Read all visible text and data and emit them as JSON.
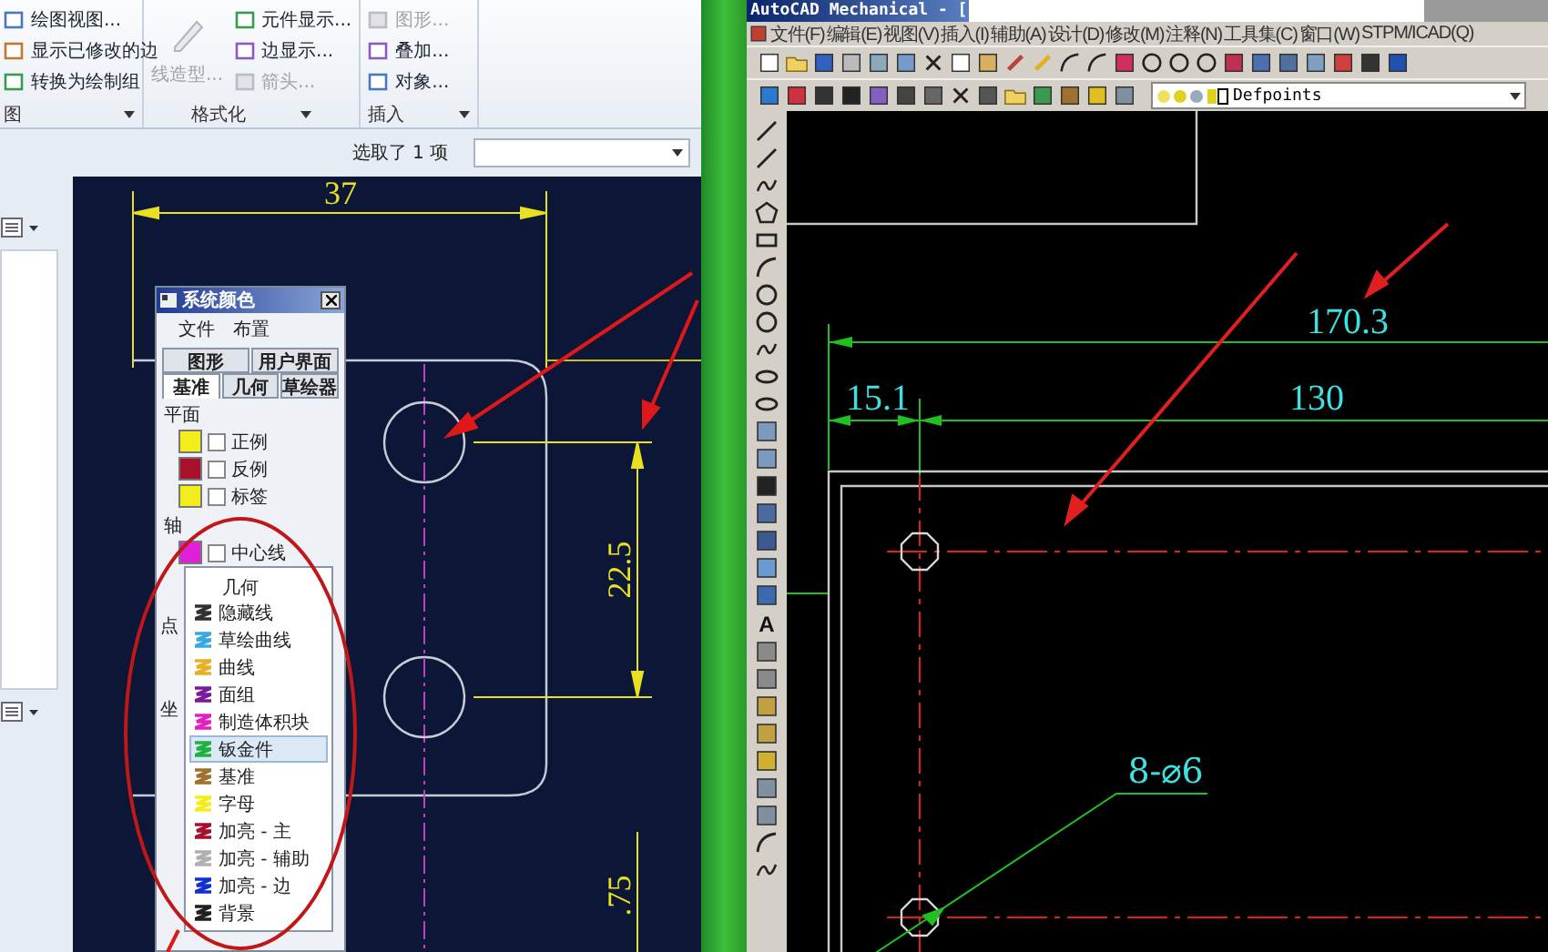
{
  "left_window": {
    "ribbon": {
      "groups": [
        {
          "label": "图",
          "items": [
            {
              "label": "绘图视图...",
              "kind": "small",
              "disabled": false
            },
            {
              "label": "显示已修改的边",
              "kind": "small",
              "disabled": false
            },
            {
              "label": "转换为绘制组",
              "kind": "small",
              "disabled": false
            }
          ]
        },
        {
          "label": "格式化",
          "items": [
            {
              "label": "线造型...",
              "kind": "large",
              "disabled": true
            },
            {
              "label": "元件显示...",
              "kind": "small",
              "disabled": false
            },
            {
              "label": "边显示...",
              "kind": "small",
              "disabled": false
            },
            {
              "label": "箭头...",
              "kind": "small",
              "disabled": true
            }
          ]
        },
        {
          "label": "插入",
          "items": [
            {
              "label": "图形...",
              "kind": "small",
              "disabled": true
            },
            {
              "label": "叠加...",
              "kind": "small",
              "disabled": false
            },
            {
              "label": "对象...",
              "kind": "small",
              "disabled": false
            }
          ]
        }
      ]
    },
    "selection_status": "选取了 1 项",
    "drawing": {
      "width_dimension": "37",
      "spacing_dimension": "22.5",
      "lower_dimension": ".75"
    },
    "dialog": {
      "title": "系统颜色",
      "menu": [
        "文件",
        "布置"
      ],
      "tab_rows": [
        [
          {
            "label": "图形",
            "selected": false
          },
          {
            "label": "用户界面",
            "selected": false
          }
        ],
        [
          {
            "label": "基准",
            "selected": true
          },
          {
            "label": "几何",
            "selected": false
          },
          {
            "label": "草绘器",
            "selected": false
          }
        ]
      ],
      "sections": [
        {
          "label": "平面",
          "rows": [
            {
              "label": "正例",
              "checked": false,
              "color": "#f2ee1c"
            },
            {
              "label": "反例",
              "checked": false,
              "color": "#a8102c"
            },
            {
              "label": "标签",
              "checked": false,
              "color": "#f2ee1c"
            }
          ]
        },
        {
          "label": "轴",
          "rows": [
            {
              "label": "中心线",
              "checked": false,
              "color": "#e020d8"
            }
          ]
        }
      ],
      "side_labels": [
        "点",
        "坐"
      ],
      "color_list": {
        "header": "几何",
        "items": [
          {
            "label": "隐藏线",
            "color": "#303030",
            "selected": false
          },
          {
            "label": "草绘曲线",
            "color": "#3aa8e0",
            "selected": false
          },
          {
            "label": "曲线",
            "color": "#e8b020",
            "selected": false
          },
          {
            "label": "面组",
            "color": "#7a1a9a",
            "selected": false
          },
          {
            "label": "制造体积块",
            "color": "#e020c0",
            "selected": false
          },
          {
            "label": "钣金件",
            "color": "#20b040",
            "selected": true
          },
          {
            "label": "基准",
            "color": "#a07030",
            "selected": false
          },
          {
            "label": "字母",
            "color": "#f2ee1c",
            "selected": false
          },
          {
            "label": "加亮 - 主",
            "color": "#a8102c",
            "selected": false
          },
          {
            "label": "加亮 - 辅助",
            "color": "#b0b0b0",
            "selected": false
          },
          {
            "label": "加亮 - 边",
            "color": "#1030d0",
            "selected": false
          },
          {
            "label": "背景",
            "color": "#202020",
            "selected": false
          }
        ]
      }
    }
  },
  "right_window": {
    "title": "AutoCAD Mechanical - [",
    "menu": [
      "文件(F)",
      "编辑(E)",
      "视图(V)",
      "插入(I)",
      "辅助(A)",
      "设计(D)",
      "修改(M)",
      "注释(N)",
      "工具集(C)",
      "窗口(W)",
      "STPM/ICAD(Q)"
    ],
    "layer": "Defpoints",
    "text_tool": "A",
    "drawing": {
      "overall_dimension": "170.3",
      "offset_dimension": "15.1",
      "span_dimension": "130",
      "hole_callout": "8-⌀6"
    }
  }
}
